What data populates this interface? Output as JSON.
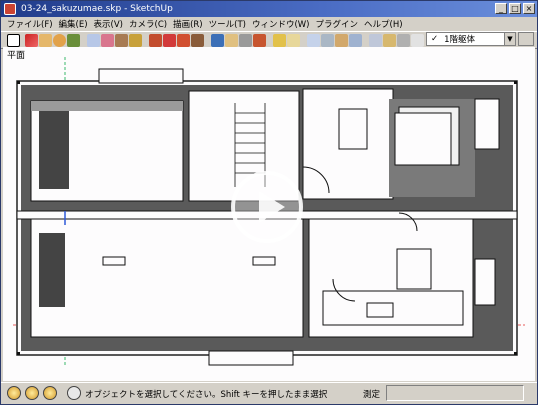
{
  "window": {
    "title": "03-24_sakuzumae.skp - SketchUp"
  },
  "menu": [
    "ファイル(F)",
    "編集(E)",
    "表示(V)",
    "カメラ(C)",
    "描画(R)",
    "ツール(T)",
    "ウィンドウ(W)",
    "プラグイン",
    "ヘルプ(H)"
  ],
  "toolbar": {
    "layer_check": "✓",
    "layer_name": "1階躯体"
  },
  "viewport": {
    "scene_label": "平面"
  },
  "status": {
    "message": "オブジェクトを選択してください。Shift キーを押したまま選択",
    "measure_label": "測定",
    "measure_value": ""
  }
}
